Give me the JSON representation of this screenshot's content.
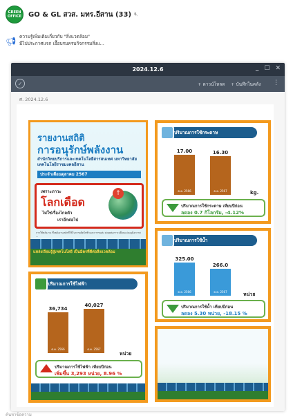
{
  "chat": {
    "group_name": "GO & GL สวส. มทร.อีสาน (33)",
    "mute_icon": "speaker-muted-icon",
    "logo_line1": "GREEN",
    "logo_line2": "OFFICE"
  },
  "announcement": {
    "icon": "megaphone-icon",
    "line1": "ความรู้เพิ่มเติมเกี่ยวกับ \"สิ่งแวดล้อม\"",
    "line2": "มีไปประกาศแจก เอื้อบรมครบกิจกรรมสิ่งแ..."
  },
  "viewer": {
    "title": "2024.12.6",
    "minimize": "_",
    "maximize": "☐",
    "close": "✕",
    "download_label": "+ ดาวน์โหลด",
    "save_label": "+ บันทึกในคลัง",
    "more": "⋮",
    "date_label": "ศ. 2024.12.6"
  },
  "poster_main": {
    "title1": "รายงานสถิติ",
    "title2": "การอนุรักษ์พลังงาน",
    "subtitle": "สำนักวิทยบริการและเทคโนโลยีสารสนเทศ มหาวิทยาลัยเทคโนโลยีราชมงคลอีสาน",
    "month": "ประจำเดือนตุลาคม 2567",
    "hot_small": "เพราะภาวะ",
    "hot_big": "โลกเดือด",
    "hot_line1": "ไม่ใช่เรื่องไกลตัว",
    "hot_line2": "เราอีกต่อไป",
    "body": "การใช้พลังงาน ซึ่งพลังงานหลักที่ใช้ในการผลิตไฟฟ้าและการขนส่ง ส่งผลต่อการเปลี่ยนแปลงภูมิอากาศ ...",
    "footer": "แหล่งเรียนรู้สู่เทคโนโลยี เป็นมิตรที่ดีต่อสิ่งแวดล้อม"
  },
  "paper_panel": {
    "title": "ปริมาณการใช้กระดาษ",
    "unit": "kg.",
    "summary1": "ปริมาณการใช้กระดาษ เทียบปีก่อน",
    "summary2": "ลดลง 0.7 กิโลกรัม, -4.12%"
  },
  "water_panel": {
    "title": "ปริมาณการใช้น้ำ",
    "unit": "หน่วย",
    "summary1": "ปริมาณการใช้น้ำ เทียบปีก่อน",
    "summary2": "ลดลง 5.30 หน่วย, -18.15 %"
  },
  "electric_panel": {
    "title": "ปริมาณการใช้ไฟฟ้า",
    "unit": "หน่วย",
    "summary1": "ปริมาณการใช้ไฟฟ้า เทียบปีก่อน",
    "summary2": "เพิ่มขึ้น 3,293 หน่วย, 8.96 %"
  },
  "chart_data": [
    {
      "type": "bar",
      "title": "ปริมาณการใช้กระดาษ",
      "categories": [
        "ต.ค. 2566",
        "ต.ค. 2567"
      ],
      "values": [
        17.0,
        16.3
      ],
      "value_labels": [
        "17.00",
        "16.30"
      ],
      "ylabel": "kg."
    },
    {
      "type": "bar",
      "title": "ปริมาณการใช้น้ำ",
      "categories": [
        "ต.ค. 2566",
        "ต.ค. 2567"
      ],
      "values": [
        325.0,
        266.0
      ],
      "value_labels": [
        "325.00",
        "266.0"
      ],
      "ylabel": "หน่วย"
    },
    {
      "type": "bar",
      "title": "ปริมาณการใช้ไฟฟ้า",
      "categories": [
        "ต.ค. 2566",
        "ต.ค. 2567"
      ],
      "values": [
        36734,
        40027
      ],
      "value_labels": [
        "36,734",
        "40,027"
      ],
      "ylabel": "หน่วย"
    }
  ],
  "footer": {
    "input_placeholder": "ค้นหาข้อความ"
  },
  "colors": {
    "frame": "#f39a1e",
    "paper_bar": "#b5651d",
    "water_bar": "#3a9ad9",
    "electric_bar": "#b5651d",
    "down": "#3c9a3c",
    "up": "#d42a1c"
  }
}
